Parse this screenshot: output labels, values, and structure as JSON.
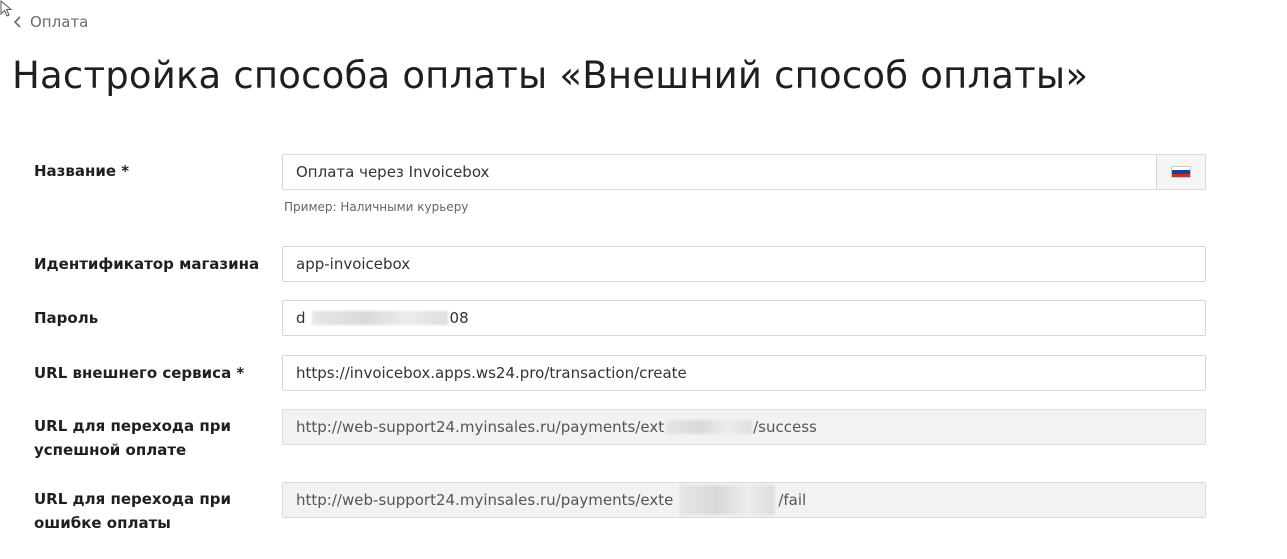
{
  "breadcrumb": {
    "back_label": "Оплата"
  },
  "page": {
    "title": "Настройка способа оплаты «Внешний способ оплаты»"
  },
  "form": {
    "name": {
      "label": "Название *",
      "value": "Оплата через Invoicebox",
      "hint": "Пример: Наличными курьеру",
      "language_flag": "ru-flag-icon"
    },
    "shop_id": {
      "label": "Идентификатор магазина",
      "value": "app-invoicebox"
    },
    "password": {
      "label": "Пароль",
      "value_start": "d",
      "value_end": "08"
    },
    "external_url": {
      "label": "URL внешнего сервиса *",
      "value": "https://invoicebox.apps.ws24.pro/transaction/create"
    },
    "success_url": {
      "label": "URL для перехода при успешной оплате",
      "value_start": "http://web-support24.myinsales.ru/payments/ext",
      "value_end": "/success"
    },
    "fail_url": {
      "label": "URL для перехода при ошибке оплаты",
      "value_start": "http://web-support24.myinsales.ru/payments/exte",
      "value_end": "/fail"
    }
  },
  "colors": {
    "flag_white": "#ffffff",
    "flag_blue": "#1c3f94",
    "flag_red": "#d52b1e"
  }
}
